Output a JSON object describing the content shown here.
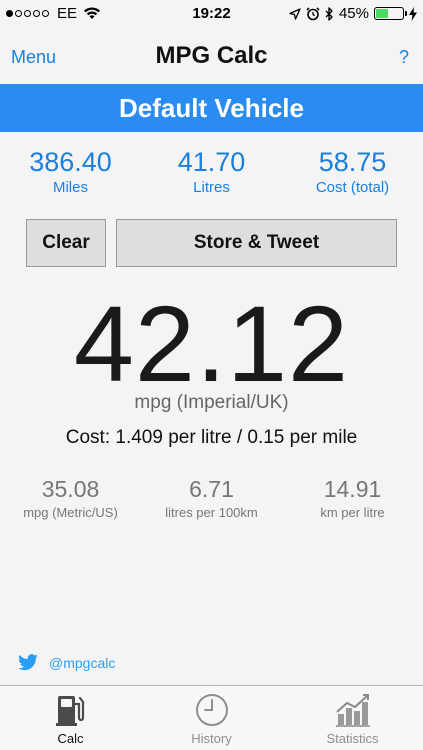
{
  "status_bar": {
    "carrier": "EE",
    "time": "19:22",
    "battery": "45%",
    "battery_level": 0.45,
    "signal_bars": 1
  },
  "nav": {
    "menu_label": "Menu",
    "title": "MPG Calc",
    "help_label": "?"
  },
  "vehicle": {
    "name": "Default Vehicle"
  },
  "inputs": [
    {
      "value": "386.40",
      "label": "Miles"
    },
    {
      "value": "41.70",
      "label": "Litres"
    },
    {
      "value": "58.75",
      "label": "Cost (total)"
    }
  ],
  "buttons": {
    "clear": "Clear",
    "store": "Store & Tweet"
  },
  "result": {
    "value": "42.12",
    "unit": "mpg (Imperial/UK)",
    "cost_line": "Cost: 1.409 per litre / 0.15 per mile"
  },
  "secondary": [
    {
      "value": "35.08",
      "label": "mpg (Metric/US)"
    },
    {
      "value": "6.71",
      "label": "litres per 100km"
    },
    {
      "value": "14.91",
      "label": "km per litre"
    }
  ],
  "twitter": {
    "handle": "@mpgcalc"
  },
  "tabs": [
    {
      "label": "Calc",
      "icon": "fuel-pump-icon",
      "active": true
    },
    {
      "label": "History",
      "icon": "clock-icon",
      "active": false
    },
    {
      "label": "Statistics",
      "icon": "chart-icon",
      "active": false
    }
  ],
  "colors": {
    "accent": "#1b7fe0",
    "banner": "#2a8cf0",
    "battery": "#4cd964",
    "twitter": "#2a9df4"
  }
}
